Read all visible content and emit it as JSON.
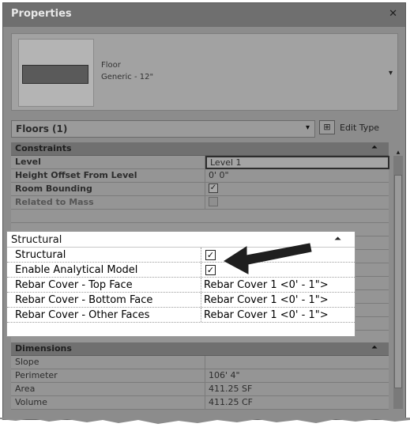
{
  "panel": {
    "title": "Properties",
    "close_glyph": "✕"
  },
  "preview": {
    "type_name": "Floor",
    "type_subname": "Generic - 12\"",
    "arrow_glyph": "▾",
    "icon": "type-preview-icon"
  },
  "type_selector": {
    "label": "Floors (1)",
    "caret": "▾",
    "edit_icon": "edit-type-icon",
    "edit_label": "Edit Type"
  },
  "groups": {
    "constraints": {
      "title": "Constraints",
      "toggle": "⏶",
      "rows": [
        {
          "name": "Level",
          "value": "Level 1"
        },
        {
          "name": "Height Offset From Level",
          "value": "0' 0\""
        },
        {
          "name": "Room Bounding",
          "checked": true
        },
        {
          "name": "Related to Mass",
          "checked": false
        }
      ]
    },
    "structural": {
      "title": "Structural",
      "toggle": "⏶",
      "rows": [
        {
          "name": "Structural",
          "checked": true
        },
        {
          "name": "Enable Analytical Model",
          "checked": true
        },
        {
          "name": "Rebar Cover - Top Face",
          "value": "Rebar Cover 1 <0' - 1\">"
        },
        {
          "name": "Rebar Cover - Bottom Face",
          "value": "Rebar Cover 1 <0' - 1\">"
        },
        {
          "name": "Rebar Cover - Other Faces",
          "value": "Rebar Cover 1 <0' - 1\">"
        }
      ]
    },
    "dimensions": {
      "title": "Dimensions",
      "toggle": "⏶",
      "rows": [
        {
          "name": "Slope",
          "value": ""
        },
        {
          "name": "Perimeter",
          "value": "106' 4\""
        },
        {
          "name": "Area",
          "value": "411.25 SF"
        },
        {
          "name": "Volume",
          "value": "411.25 CF"
        }
      ]
    }
  },
  "checkmark_glyph": "✓",
  "colors": {
    "panel_bg": "#8c8c8c",
    "overlay_bg": "#ffffff",
    "arrow": "#1f1f1f"
  }
}
